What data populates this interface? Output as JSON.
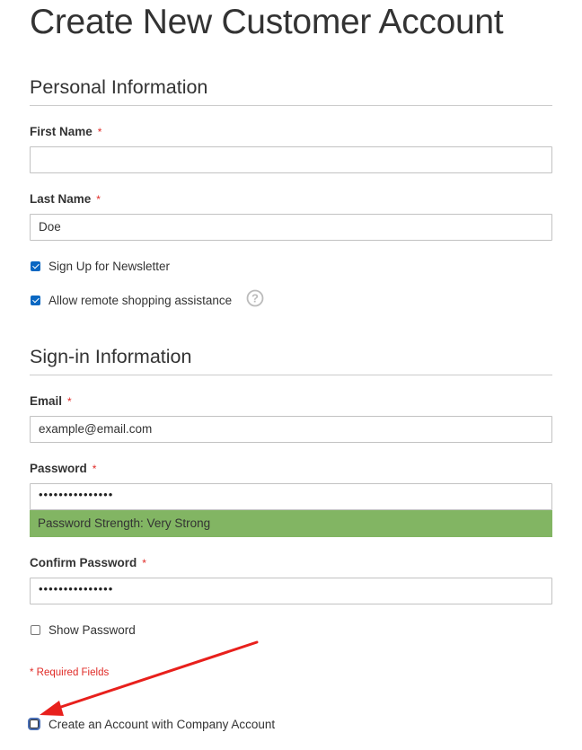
{
  "page": {
    "title": "Create New Customer Account"
  },
  "personal": {
    "section_title": "Personal Information",
    "first_name": {
      "label": "First Name",
      "required_mark": "*",
      "value": ""
    },
    "last_name": {
      "label": "Last Name",
      "required_mark": "*",
      "value": "Doe"
    },
    "newsletter": {
      "label": "Sign Up for Newsletter",
      "checked": true
    },
    "remote_assistance": {
      "label": "Allow remote shopping assistance",
      "checked": true,
      "help_icon": "question-circle-icon"
    }
  },
  "signin": {
    "section_title": "Sign-in Information",
    "email": {
      "label": "Email",
      "required_mark": "*",
      "value": "example@email.com"
    },
    "password": {
      "label": "Password",
      "required_mark": "*",
      "masked_value": "•••••••••••••••"
    },
    "password_strength": "Password Strength: Very Strong",
    "confirm_password": {
      "label": "Confirm Password",
      "required_mark": "*",
      "masked_value": "•••••••••••••••"
    },
    "show_password": {
      "label": "Show Password",
      "checked": false
    }
  },
  "required_note": "* Required Fields",
  "company_account": {
    "label": "Create an Account with Company Account",
    "checked": false
  },
  "colors": {
    "required": "#e02b27",
    "checkbox_checked": "#0a67c2",
    "strength_bar": "#82b563",
    "annotation_arrow": "#e8201c"
  }
}
